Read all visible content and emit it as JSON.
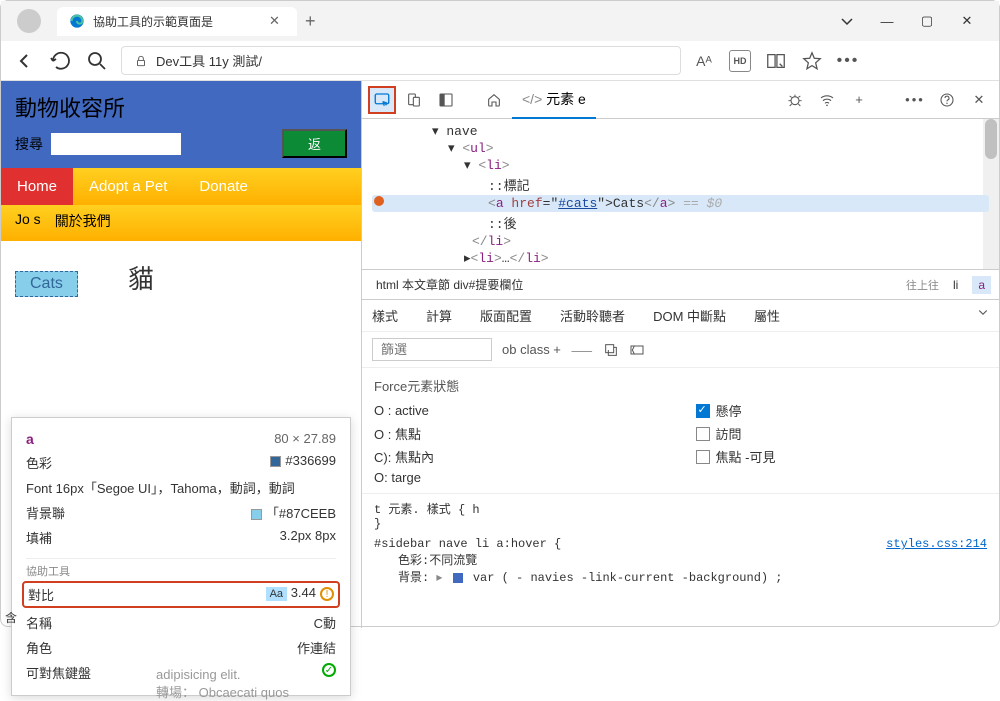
{
  "browser": {
    "tab_title": "協助工具的示範頁面是",
    "url": "Dev工具 11y 測試/",
    "toolbar": {
      "aa": "Aᴬ",
      "hd": "HD"
    }
  },
  "page": {
    "title": "動物收容所",
    "search_label": "搜尋",
    "go_btn": "返",
    "nav": [
      "Home",
      "Adopt a Pet",
      "Donate"
    ],
    "nav2": [
      "Jo s",
      "關於我們"
    ],
    "cats_link": "Cats",
    "heading": "貓",
    "overflow": [
      "adipisicing elit.",
      "轉場：   Obcaecati quos"
    ],
    "footer_char": "含"
  },
  "tooltip": {
    "tag": "a",
    "dims": "80 × 27.89",
    "rows": {
      "color_label": "色彩",
      "color_val": "#336699",
      "font_label": "Font 16px「Segoe UI」，Tahoma，動詞，動詞",
      "bg_label": "背景聯",
      "bg_val": "「#87CEEB",
      "padding_label": "填補",
      "padding_val": "3.2px 8px"
    },
    "section": "協助工具",
    "a11y": {
      "contrast_label": "對比",
      "contrast_aa": "Aa",
      "contrast_val": "3.44",
      "name_label": "名稱",
      "name_val": "C動",
      "role_label": "角色",
      "role_val": "作連結",
      "focusable_label": "可對焦鍵盤"
    }
  },
  "devtools": {
    "tabs": {
      "elements": "元素 e"
    },
    "dom": {
      "nave": "▾ nave",
      "ul": "<ul>",
      "li": "<li>",
      "before": "::標記",
      "a_open": "<a ",
      "href_name": "href",
      "href_eq": "=\"",
      "href_val": "#cats",
      "a_mid": "\">",
      "a_text": "Cats",
      "a_close": "</a>",
      "eq0": " == $0",
      "after": "::後",
      "li_close": "</li>",
      "li2o": "<li>",
      "li2c": "</li>"
    },
    "breadcrumb": {
      "path": "html 本文章節 div#提要欄位",
      "nav": "往上往",
      "li": "li",
      "a": "a"
    },
    "panel_tabs": [
      "樣式",
      "計算",
      "版面配置",
      "活動聆聽者",
      "DOM 中斷點",
      "屬性"
    ],
    "filter_placeholder": "篩選",
    "cls_text": "ob class +",
    "force": {
      "title": "Force元素狀態",
      "items": {
        "active": "O : active",
        "hover": "懸停",
        "focus": "O : 焦點",
        "visited": "訪問",
        "focus_within": "C): 焦點內",
        "focus_visible": "焦點 -可見",
        "target": "O: targe"
      }
    },
    "styles": {
      "rule1_sel": "t 元素. 樣式 { h",
      "rule1_close": "}",
      "rule2_sel": "#sidebar nave        li a:hover {",
      "rule2_src": "styles.css:214",
      "prop_color": "色彩:不同流覽",
      "prop_bg_label": "背景:",
      "prop_bg_val": "var ( - navies -link-current -background) ;"
    }
  }
}
